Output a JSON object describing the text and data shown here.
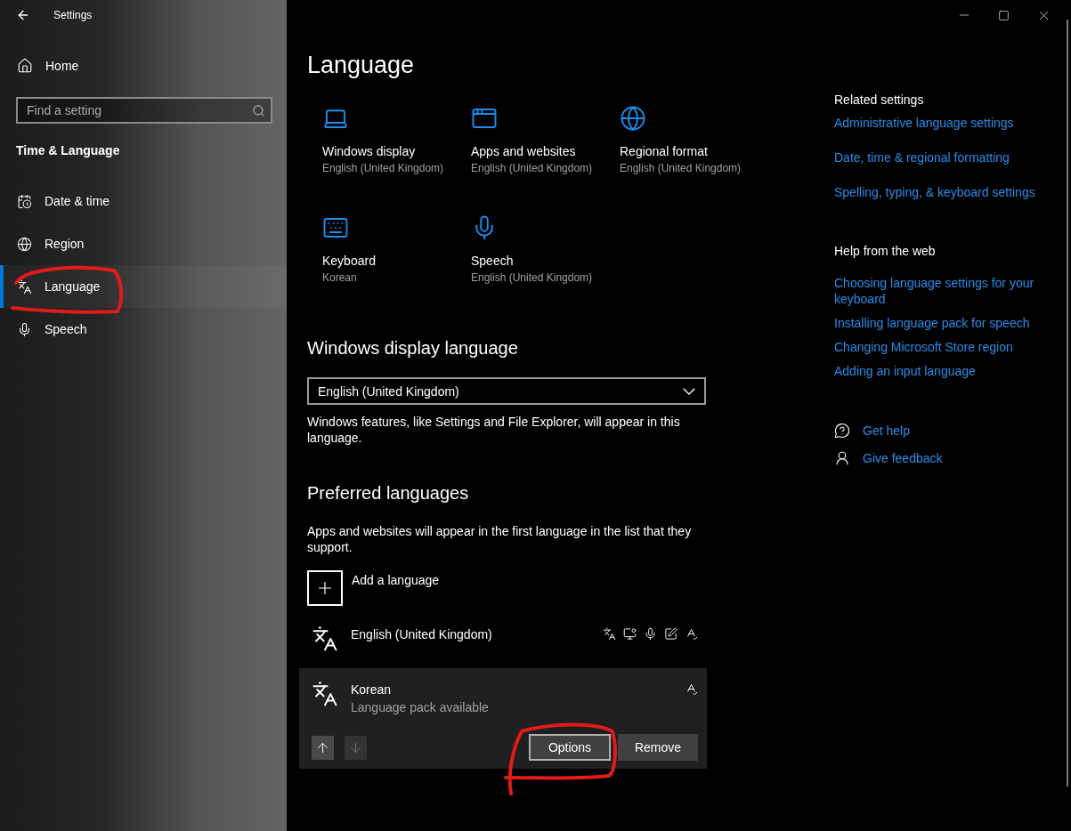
{
  "window": {
    "title": "Settings"
  },
  "sidebar": {
    "home": "Home",
    "search": {
      "placeholder": "Find a setting"
    },
    "section": "Time & Language",
    "items": [
      {
        "label": "Date & time",
        "kind": "calendar",
        "selected": false
      },
      {
        "label": "Region",
        "kind": "globe",
        "selected": false
      },
      {
        "label": "Language",
        "kind": "language",
        "selected": true
      },
      {
        "label": "Speech",
        "kind": "mic",
        "selected": false
      }
    ]
  },
  "page": {
    "title": "Language",
    "tiles": [
      {
        "kind": "laptop",
        "title": "Windows display",
        "value": "English (United Kingdom)"
      },
      {
        "kind": "window",
        "title": "Apps and websites",
        "value": "English (United Kingdom)"
      },
      {
        "kind": "globe",
        "title": "Regional format",
        "value": "English (United Kingdom)"
      },
      {
        "kind": "keyboard",
        "title": "Keyboard",
        "value": "Korean"
      },
      {
        "kind": "mic",
        "title": "Speech",
        "value": "English (United Kingdom)"
      }
    ],
    "display_language": {
      "heading": "Windows display language",
      "dropdown": {
        "value": "English (United Kingdom)"
      },
      "note": "Windows features, like Settings and File Explorer, will appear in this language."
    },
    "preferred": {
      "heading": "Preferred languages",
      "note": "Apps and websites will appear in the first language in the list that they support.",
      "add_label": "Add a language",
      "languages": [
        {
          "name": "English (United Kingdom)",
          "features": [
            {
              "kind": "display"
            },
            {
              "kind": "text-to-speech"
            },
            {
              "kind": "speech"
            },
            {
              "kind": "handwriting"
            },
            {
              "kind": "spelling"
            }
          ],
          "selected": false
        },
        {
          "name": "Korean",
          "status": "Language pack available",
          "features": [
            {
              "kind": "spelling"
            }
          ],
          "selected": true,
          "actions": {
            "move_up": {
              "disabled": false
            },
            "move_down": {
              "disabled": true
            },
            "buttons": [
              {
                "label": "Options",
                "focused": true
              },
              {
                "label": "Remove",
                "focused": false
              }
            ]
          }
        }
      ]
    }
  },
  "related": {
    "heading": "Related settings",
    "links": [
      "Administrative language settings",
      "Date, time & regional formatting",
      "Spelling, typing, & keyboard settings"
    ]
  },
  "help": {
    "heading": "Help from the web",
    "links": [
      "Choosing language settings for your keyboard",
      "Installing language pack for speech",
      "Changing Microsoft Store region",
      "Adding an input language"
    ]
  },
  "support": [
    {
      "kind": "help",
      "label": "Get help"
    },
    {
      "kind": "feedback",
      "label": "Give feedback"
    }
  ]
}
